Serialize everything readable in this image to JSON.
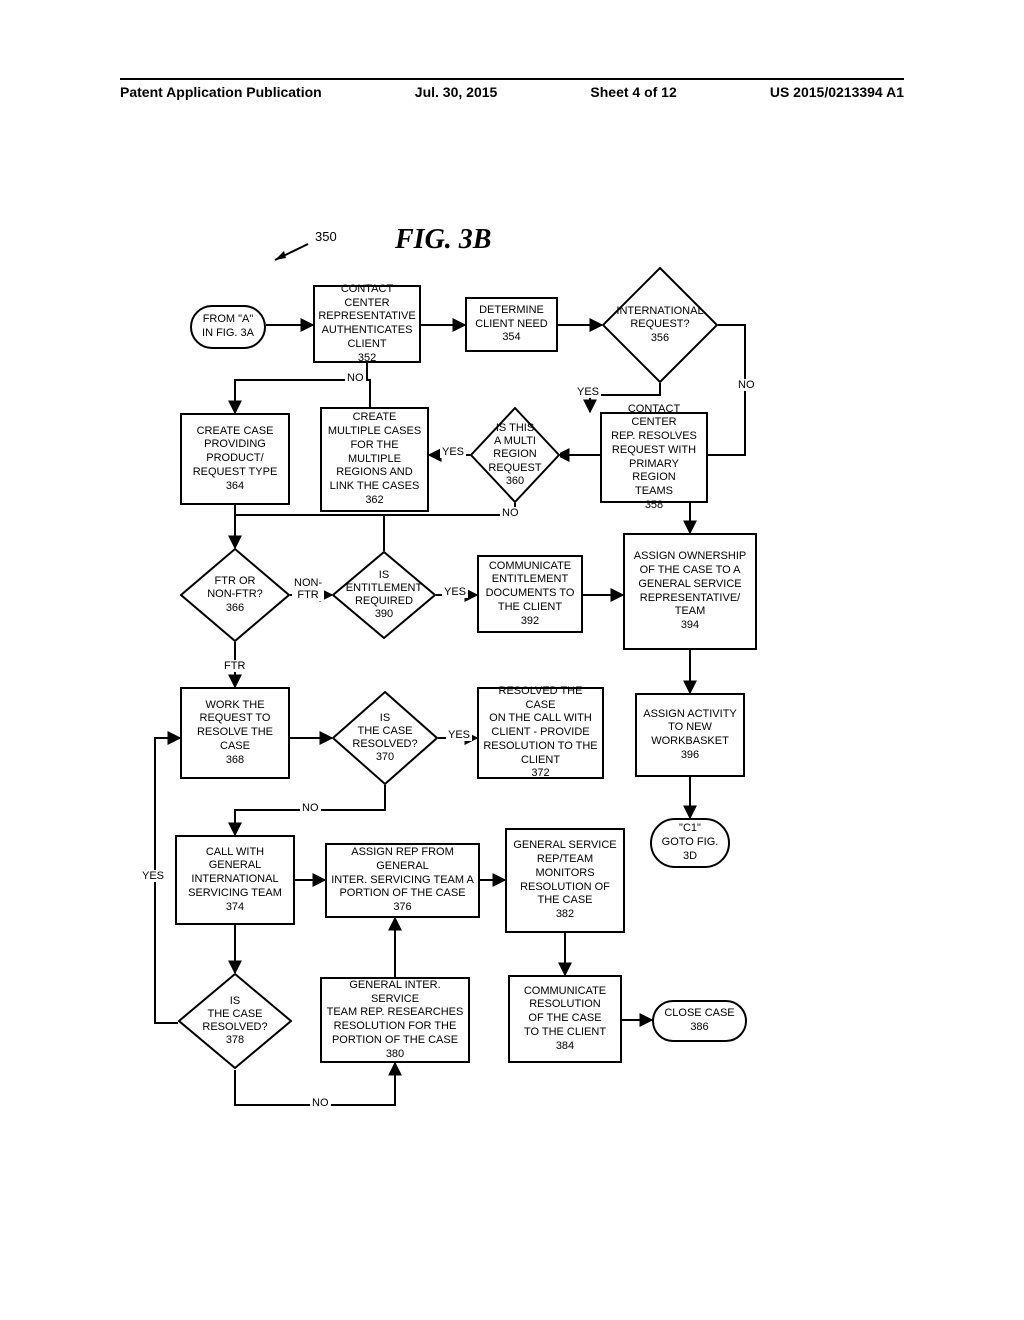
{
  "header": {
    "pub_type": "Patent Application Publication",
    "date": "Jul. 30, 2015",
    "sheet": "Sheet 4 of 12",
    "pub_no": "US 2015/0213394 A1"
  },
  "figure": {
    "title": "FIG. 3B",
    "ref": "350"
  },
  "nodes": {
    "fromA": "FROM \"A\"\nIN FIG. 3A",
    "n352": "CONTACT CENTER\nREPRESENTATIVE\nAUTHENTICATES\nCLIENT\n352",
    "n354": "DETERMINE\nCLIENT NEED\n354",
    "n356": "INTERNATIONAL\nREQUEST?\n356",
    "n358": "CONTACT CENTER\nREP. RESOLVES\nREQUEST WITH\nPRIMARY REGION\nTEAMS\n358",
    "n360": "IS THIS\nA MULTI\nREGION\nREQUEST\n360",
    "n362": "CREATE\nMULTIPLE CASES\nFOR THE\nMULTIPLE\nREGIONS AND\nLINK THE CASES\n362",
    "n364": "CREATE CASE\nPROVIDING\nPRODUCT/\nREQUEST TYPE\n364",
    "n366": "FTR OR\nNON-FTR?\n366",
    "n368": "WORK THE\nREQUEST TO\nRESOLVE THE\nCASE\n368",
    "n370": "IS\nTHE CASE\nRESOLVED?\n370",
    "n372": "RESOLVED THE CASE\nON THE CALL WITH\nCLIENT - PROVIDE\nRESOLUTION TO THE\nCLIENT\n372",
    "n374": "CALL WITH\nGENERAL\nINTERNATIONAL\nSERVICING TEAM\n374",
    "n376": "ASSIGN REP FROM GENERAL\nINTER. SERVICING TEAM  A\nPORTION OF THE CASE\n376",
    "n378": "IS\nTHE CASE\nRESOLVED?\n378",
    "n380": "GENERAL INTER. SERVICE\nTEAM REP. RESEARCHES\nRESOLUTION FOR THE\nPORTION OF THE CASE\n380",
    "n382": "GENERAL SERVICE\nREP/TEAM\nMONITORS\nRESOLUTION OF\nTHE CASE\n382",
    "n384": "COMMUNICATE\nRESOLUTION\nOF THE CASE\nTO THE CLIENT\n384",
    "n386": "CLOSE CASE\n386",
    "n390": "IS\nENTITLEMENT\nREQUIRED\n390",
    "n392": "COMMUNICATE\nENTITLEMENT\nDOCUMENTS TO\nTHE CLIENT\n392",
    "n394": "ASSIGN OWNERSHIP\nOF THE CASE TO A\nGENERAL SERVICE\nREPRESENTATIVE/\nTEAM\n394",
    "n396": "ASSIGN ACTIVITY\nTO NEW\nWORKBASKET\n396",
    "c1": "\"C1\"\nGOTO FIG.\n3D"
  },
  "labels": {
    "yes": "YES",
    "no": "NO",
    "ftr": "FTR",
    "nonftr": "NON-\nFTR"
  }
}
